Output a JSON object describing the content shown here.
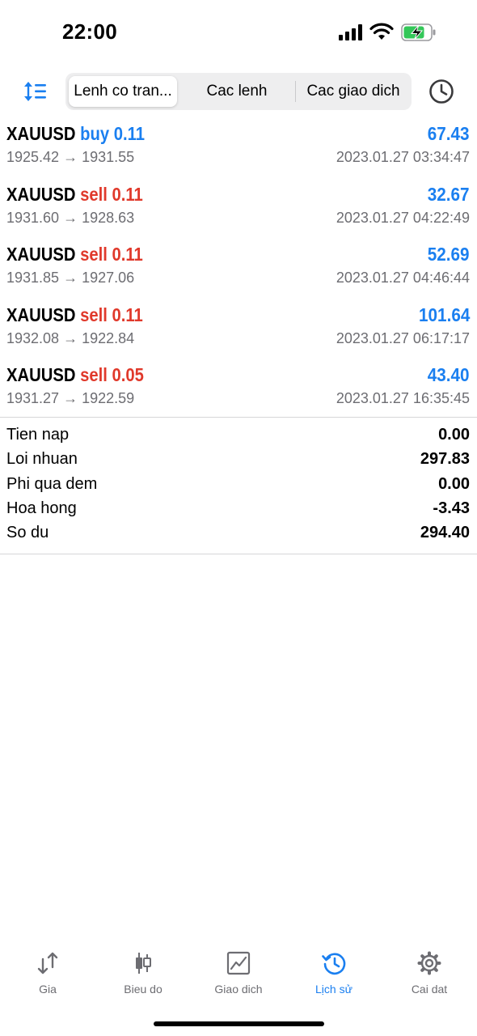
{
  "status_bar": {
    "time": "22:00"
  },
  "segments": [
    {
      "label": "Lenh co tran..."
    },
    {
      "label": "Cac lenh"
    },
    {
      "label": "Cac giao dich"
    }
  ],
  "deals": [
    {
      "symbol": "XAUUSD",
      "side": "buy",
      "volume": "0.11",
      "profit": "67.43",
      "prices": "1925.42 → 1931.55",
      "time": "2023.01.27 03:34:47"
    },
    {
      "symbol": "XAUUSD",
      "side": "sell",
      "volume": "0.11",
      "profit": "32.67",
      "prices": "1931.60 → 1928.63",
      "time": "2023.01.27 04:22:49"
    },
    {
      "symbol": "XAUUSD",
      "side": "sell",
      "volume": "0.11",
      "profit": "52.69",
      "prices": "1931.85 → 1927.06",
      "time": "2023.01.27 04:46:44"
    },
    {
      "symbol": "XAUUSD",
      "side": "sell",
      "volume": "0.11",
      "profit": "101.64",
      "prices": "1932.08 → 1922.84",
      "time": "2023.01.27 06:17:17"
    },
    {
      "symbol": "XAUUSD",
      "side": "sell",
      "volume": "0.05",
      "profit": "43.40",
      "prices": "1931.27 → 1922.59",
      "time": "2023.01.27 16:35:45"
    }
  ],
  "summary": [
    {
      "label": "Tien nap",
      "value": "0.00"
    },
    {
      "label": "Loi nhuan",
      "value": "297.83"
    },
    {
      "label": "Phi qua dem",
      "value": "0.00"
    },
    {
      "label": "Hoa hong",
      "value": "-3.43"
    },
    {
      "label": "So du",
      "value": "294.40"
    }
  ],
  "tabs": [
    {
      "label": "Gia",
      "icon": "arrows-updown-icon"
    },
    {
      "label": "Bieu do",
      "icon": "candlestick-icon"
    },
    {
      "label": "Giao dich",
      "icon": "trade-chart-icon"
    },
    {
      "label": "Lịch sử",
      "icon": "history-icon"
    },
    {
      "label": "Cai dat",
      "icon": "gear-icon"
    }
  ],
  "colors": {
    "accent": "#1a7ff0",
    "sell": "#e0392b",
    "secondary_text": "#6d6d72",
    "battery": "#34c759"
  }
}
